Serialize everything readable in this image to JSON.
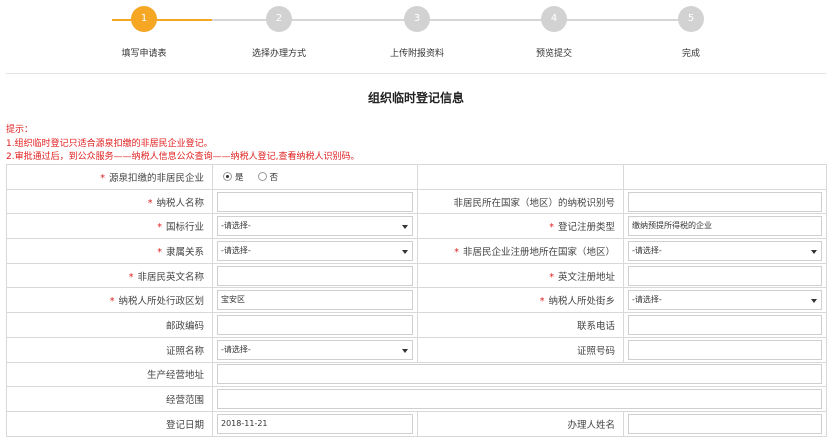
{
  "steps": [
    {
      "num": "1",
      "label": "填写申请表"
    },
    {
      "num": "2",
      "label": "选择办理方式"
    },
    {
      "num": "3",
      "label": "上传附报资料"
    },
    {
      "num": "4",
      "label": "预览提交"
    },
    {
      "num": "5",
      "label": "完成"
    }
  ],
  "current_step": 1,
  "page_title": "组织临时登记信息",
  "tips": {
    "heading": "提示：",
    "line1": "1.组织临时登记只适合源泉扣缴的非居民企业登记。",
    "line2": "2.审批通过后，到公众服务——纳税人信息公众查询——纳税人登记,查看纳税人识别码。"
  },
  "form": {
    "required_mark": "*",
    "withholding": {
      "label": "源泉扣缴的非居民企业",
      "yes": "是",
      "no": "否",
      "selected": "是"
    },
    "taxpayer_name": {
      "label": "纳税人名称",
      "value": ""
    },
    "foreign_tin": {
      "label": "非居民所在国家（地区）的纳税识别号",
      "value": ""
    },
    "industry": {
      "label": "国标行业",
      "value": "-请选择-"
    },
    "reg_type": {
      "label": "登记注册类型",
      "value": "缴纳预提所得税的企业"
    },
    "affiliation": {
      "label": "隶属关系",
      "value": "-请选择-"
    },
    "reg_country": {
      "label": "非居民企业注册地所在国家（地区）",
      "value": "-请选择-"
    },
    "english_name": {
      "label": "非居民英文名称",
      "value": ""
    },
    "english_address": {
      "label": "英文注册地址",
      "value": ""
    },
    "district": {
      "label": "纳税人所处行政区划",
      "value": "宝安区"
    },
    "street": {
      "label": "纳税人所处街乡",
      "value": "-请选择-"
    },
    "postcode": {
      "label": "邮政编码",
      "value": ""
    },
    "phone": {
      "label": "联系电话",
      "value": ""
    },
    "id_type": {
      "label": "证照名称",
      "value": "-请选择-"
    },
    "id_number": {
      "label": "证照号码",
      "value": ""
    },
    "business_address": {
      "label": "生产经营地址",
      "value": ""
    },
    "business_scope": {
      "label": "经营范围",
      "value": ""
    },
    "reg_date": {
      "label": "登记日期",
      "value": "2018-11-21"
    },
    "agent_name": {
      "label": "办理人姓名",
      "value": ""
    }
  },
  "colors": {
    "accent": "#f5a623",
    "inactive": "#d2d2d2",
    "warning": "#e02020"
  }
}
